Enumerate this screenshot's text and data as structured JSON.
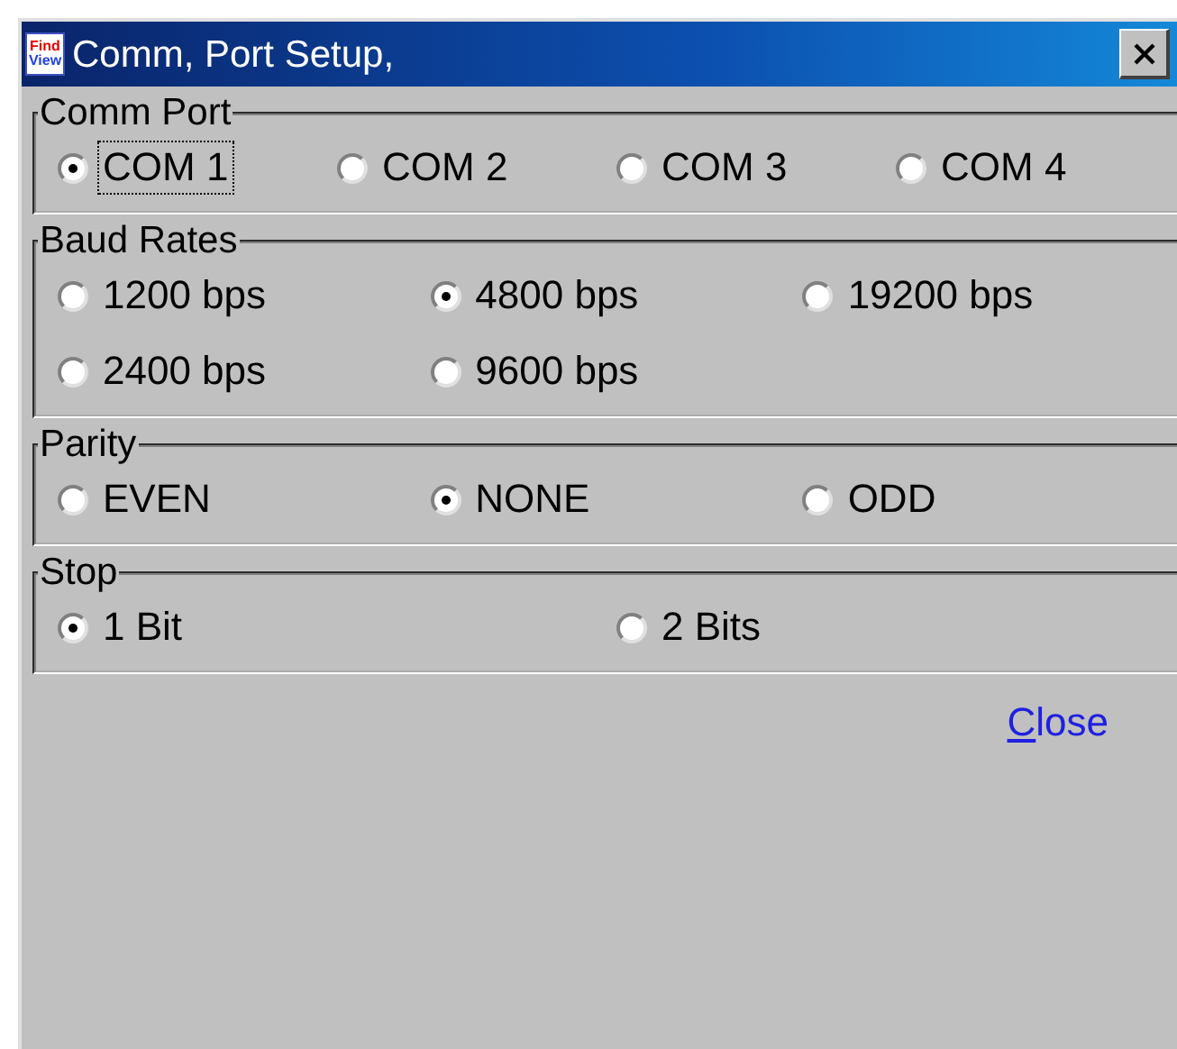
{
  "window": {
    "title": "Comm, Port Setup,",
    "logo_text": [
      "Find",
      "View"
    ]
  },
  "groups": [
    {
      "title": "Comm Port",
      "rows": [
        [
          {
            "label": "COM 1",
            "selected": true,
            "focused": true
          },
          {
            "label": "COM 2",
            "selected": false,
            "focused": false
          },
          {
            "label": "COM 3",
            "selected": false,
            "focused": false
          },
          {
            "label": "COM 4",
            "selected": false,
            "focused": false
          }
        ]
      ]
    },
    {
      "title": "Baud Rates",
      "rows": [
        [
          {
            "label": "1200 bps",
            "selected": false,
            "focused": false
          },
          {
            "label": "4800 bps",
            "selected": true,
            "focused": false
          },
          {
            "label": "19200 bps",
            "selected": false,
            "focused": false
          }
        ],
        [
          {
            "label": "2400 bps",
            "selected": false,
            "focused": false
          },
          {
            "label": "9600 bps",
            "selected": false,
            "focused": false
          }
        ]
      ]
    },
    {
      "title": "Parity",
      "rows": [
        [
          {
            "label": "EVEN",
            "selected": false,
            "focused": false
          },
          {
            "label": "NONE",
            "selected": true,
            "focused": false
          },
          {
            "label": "ODD",
            "selected": false,
            "focused": false
          }
        ]
      ]
    },
    {
      "title": "Stop",
      "rows": [
        [
          {
            "label": "1 Bit",
            "selected": true,
            "focused": false
          },
          {
            "label": "2 Bits",
            "selected": false,
            "focused": false
          }
        ]
      ]
    }
  ],
  "close_link": {
    "label": "Close"
  }
}
